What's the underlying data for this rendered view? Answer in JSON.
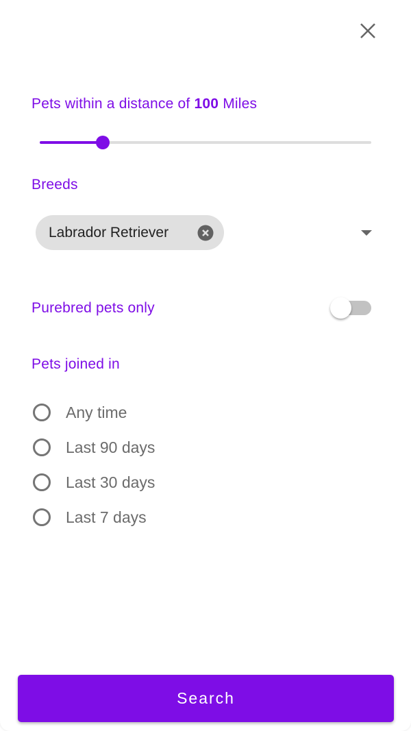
{
  "colors": {
    "accent": "#7e0de6",
    "chip_bg": "#e0e0e0",
    "track": "#dddddd",
    "radio": "#757575"
  },
  "close_icon": "close-icon",
  "distance": {
    "label_prefix": "Pets within a distance of",
    "value": "100",
    "unit": "Miles",
    "slider_fraction": 0.19
  },
  "breeds": {
    "label": "Breeds",
    "selected_chip": "Labrador Retriever",
    "chip_remove_icon": "cancel-circle-icon",
    "dropdown_icon": "arrow-drop-down-icon"
  },
  "purebred": {
    "label": "Purebred pets only",
    "enabled": false
  },
  "joined": {
    "label": "Pets joined in",
    "options": [
      {
        "label": "Any time",
        "selected": false
      },
      {
        "label": "Last 90 days",
        "selected": false
      },
      {
        "label": "Last 30 days",
        "selected": false
      },
      {
        "label": "Last 7 days",
        "selected": false
      }
    ]
  },
  "search_button": {
    "label": "Search"
  }
}
